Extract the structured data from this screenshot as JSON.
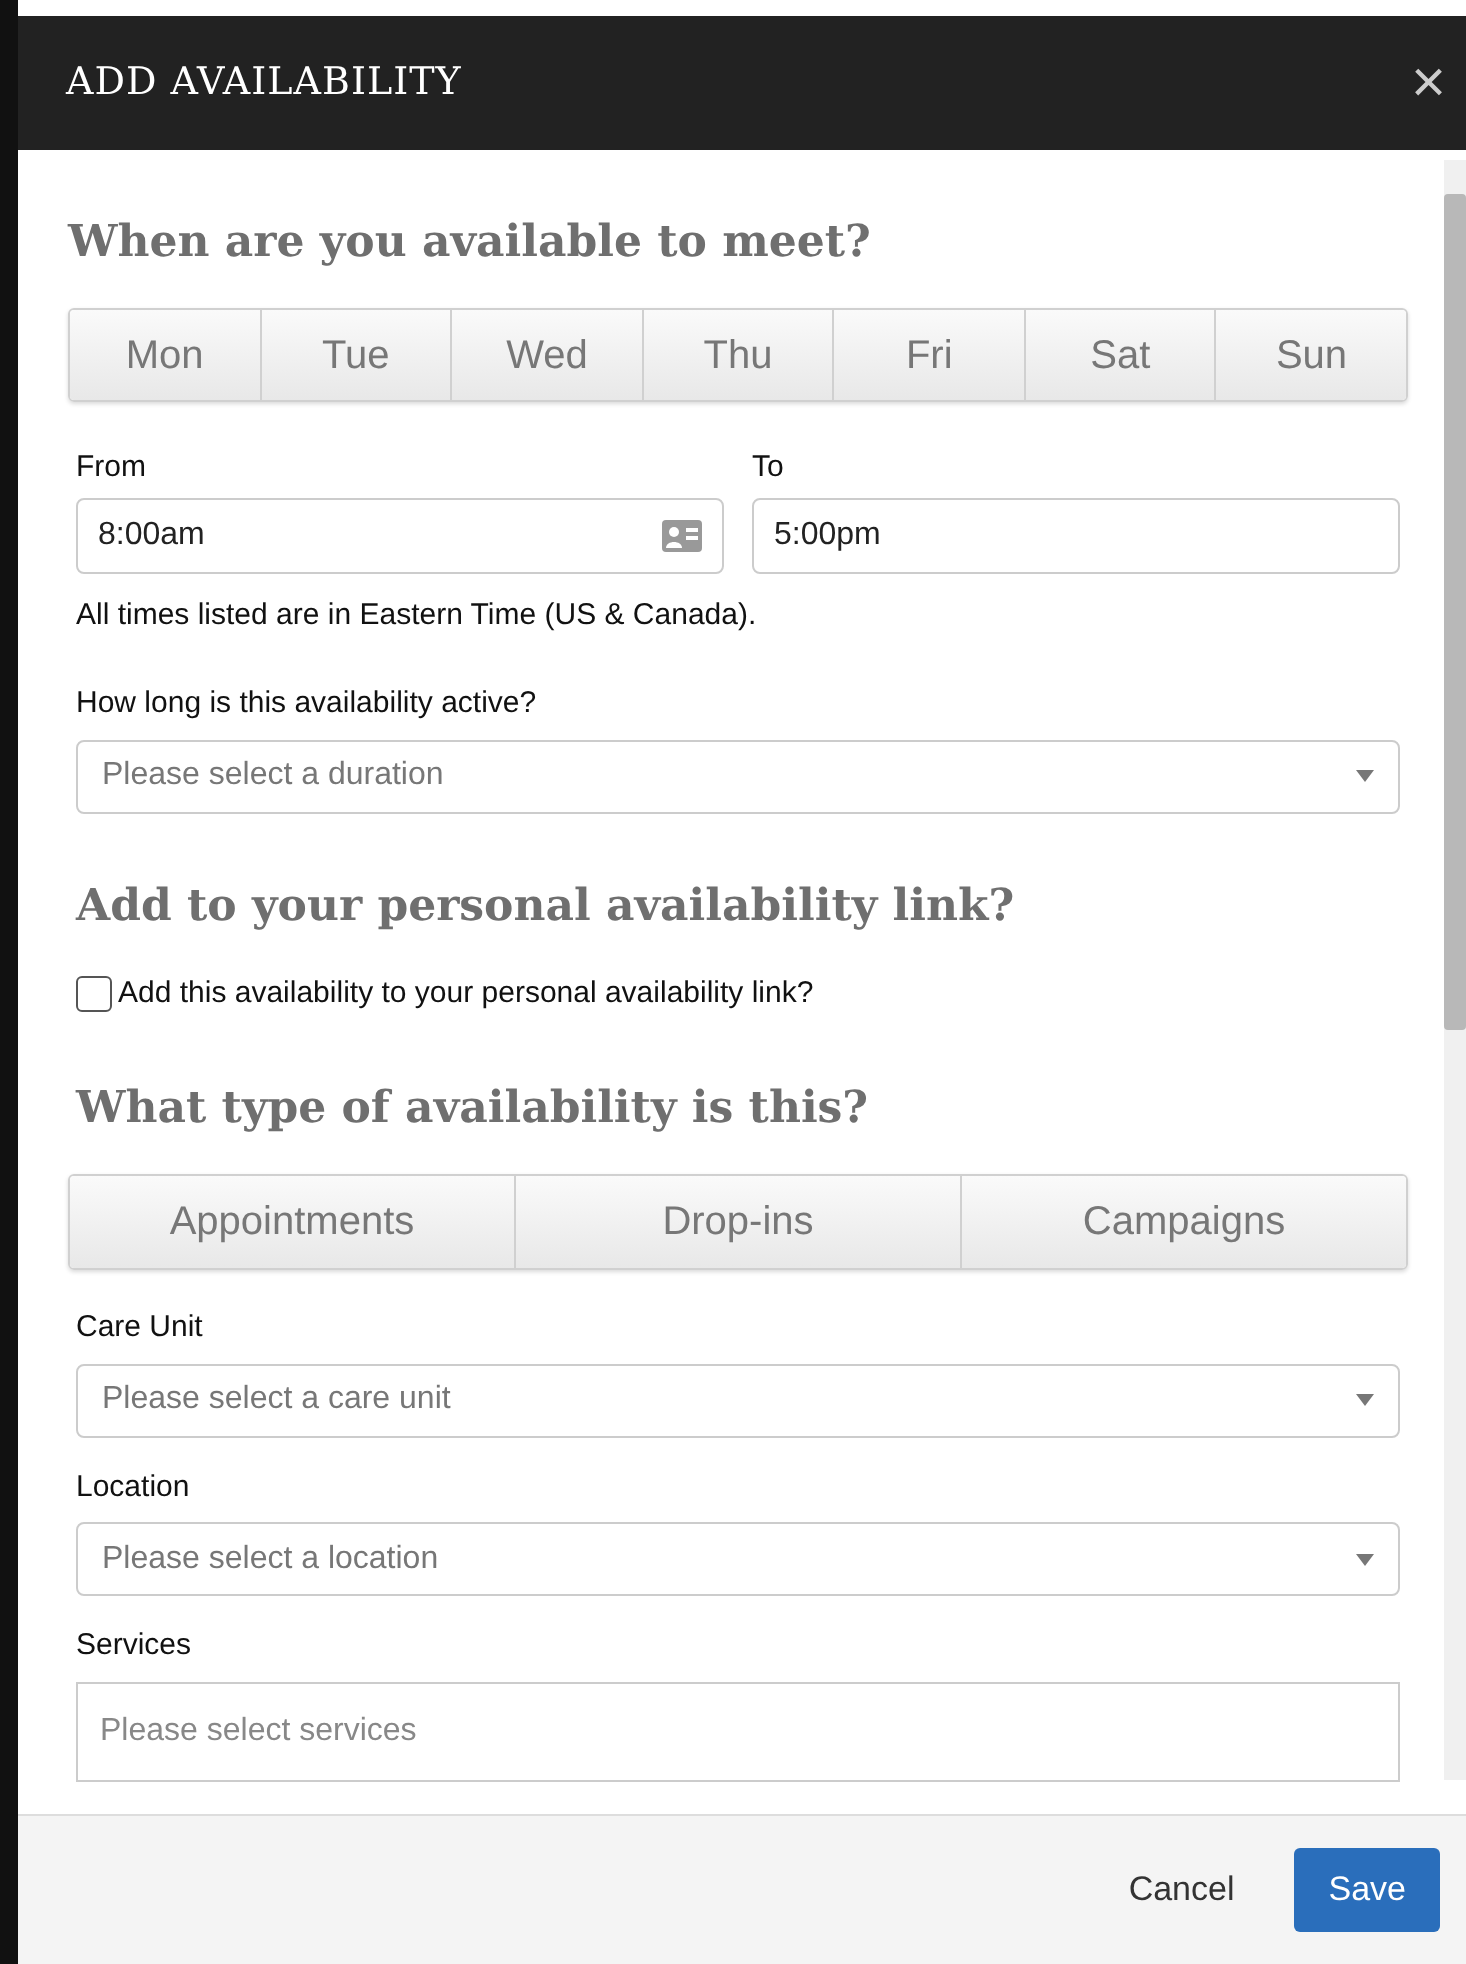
{
  "dialog": {
    "title": "ADD AVAILABILITY",
    "close": "×"
  },
  "section_1": {
    "heading": "When are you available to meet?",
    "days": [
      {
        "label": "Mon",
        "selected": false
      },
      {
        "label": "Tue",
        "selected": false
      },
      {
        "label": "Wed",
        "selected": false
      },
      {
        "label": "Thu",
        "selected": false
      },
      {
        "label": "Fri",
        "selected": false
      },
      {
        "label": "Sat",
        "selected": false
      },
      {
        "label": "Sun",
        "selected": false
      }
    ],
    "from": {
      "label": "From",
      "value": "8:00am"
    },
    "to": {
      "label": "To",
      "value": "5:00pm"
    },
    "timezone_note": "All times listed are in Eastern Time (US & Canada).",
    "duration": {
      "label": "How long is this availability active?",
      "placeholder": "Please select a duration"
    }
  },
  "section_2": {
    "heading": "Add to your personal availability link?",
    "checkbox": {
      "label": "Add this availability to your personal availability link?",
      "checked": false
    }
  },
  "section_3": {
    "heading": "What type of availability is this?",
    "types": [
      {
        "label": "Appointments",
        "selected": false
      },
      {
        "label": "Drop-ins",
        "selected": false
      },
      {
        "label": "Campaigns",
        "selected": false
      }
    ],
    "fields": [
      {
        "kind": "select",
        "label": "Care Unit",
        "placeholder": "Please select a care unit"
      },
      {
        "kind": "select",
        "label": "Location",
        "placeholder": "Please select a location"
      },
      {
        "kind": "multi",
        "label": "Services",
        "placeholder": "Please select services"
      }
    ]
  },
  "footer": {
    "cancel": "Cancel",
    "save": "Save"
  }
}
